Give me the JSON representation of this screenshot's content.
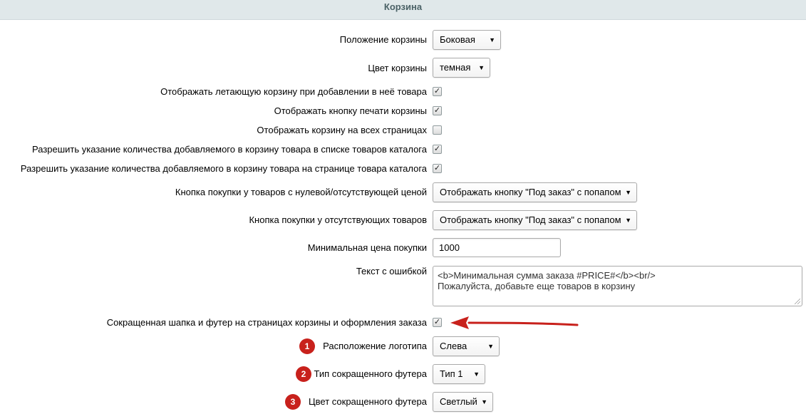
{
  "header": {
    "title": "Корзина"
  },
  "fields": {
    "basket_position": {
      "label": "Положение корзины",
      "value": "Боковая"
    },
    "basket_color": {
      "label": "Цвет корзины",
      "value": "темная"
    },
    "flying_basket": {
      "label": "Отображать летающую корзину при добавлении в неё товара",
      "checked": true
    },
    "print_button": {
      "label": "Отображать кнопку печати корзины",
      "checked": true
    },
    "all_pages": {
      "label": "Отображать корзину на всех страницах",
      "checked": false
    },
    "qty_in_list": {
      "label": "Разрешить указание количества добавляемого в корзину товара в списке товаров каталога",
      "checked": true
    },
    "qty_on_page": {
      "label": "Разрешить указание количества добавляемого в корзину товара на странице товара каталога",
      "checked": true
    },
    "zero_price_button": {
      "label": "Кнопка покупки у товаров с нулевой/отсутствующей ценой",
      "value": "Отображать кнопку \"Под заказ\" с попапом"
    },
    "missing_button": {
      "label": "Кнопка покупки у отсутствующих товаров",
      "value": "Отображать кнопку \"Под заказ\" с попапом"
    },
    "min_price": {
      "label": "Минимальная цена покупки",
      "value": "1000"
    },
    "error_text": {
      "label": "Текст с ошибкой",
      "line1": "<b>Минимальная сумма заказа #PRICE#</b><br/>",
      "line2": "Пожалуйста, добавьте еще товаров в корзину"
    },
    "short_header": {
      "label": "Сокращенная шапка и футер на страницах корзины и оформления заказа",
      "checked": true
    },
    "logo_position": {
      "badge": "1",
      "label": "Расположение логотипа",
      "value": "Слева"
    },
    "footer_type": {
      "badge": "2",
      "label": "Тип сокращенного футера",
      "value": "Тип 1"
    },
    "footer_color": {
      "badge": "3",
      "label": "Цвет сокращенного футера",
      "value": "Светлый"
    }
  },
  "icons": {
    "check": "✓",
    "dropdown": "▼"
  },
  "colors": {
    "accent_red": "#c8211c",
    "header_bg": "#e0e8ea",
    "header_text": "#4b6267"
  }
}
